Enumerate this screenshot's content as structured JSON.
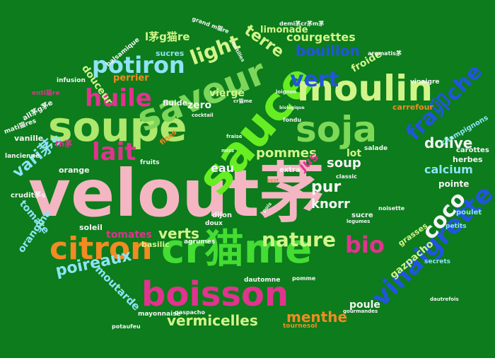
{
  "background_color": "#0c7c1c",
  "words": [
    {
      "text": "velout茅",
      "color": "#f4b6c2"
    },
    {
      "text": "soupe",
      "color": "#aee86c"
    },
    {
      "text": "sauce",
      "color": "#66ee22"
    },
    {
      "text": "saveur",
      "color": "#7cd65a"
    },
    {
      "text": "moulin",
      "color": "#d2f58a"
    },
    {
      "text": "soja",
      "color": "#7ed957"
    },
    {
      "text": "boisson",
      "color": "#e0348f"
    },
    {
      "text": "cr猫me",
      "color": "#44dd33"
    },
    {
      "text": "citron",
      "color": "#f28b22"
    },
    {
      "text": "potiron",
      "color": "#8fe3f7"
    },
    {
      "text": "vinaigrette",
      "color": "#2255dd"
    },
    {
      "text": "lait",
      "color": "#e0348f"
    },
    {
      "text": "huile",
      "color": "#e0348f"
    },
    {
      "text": "bio",
      "color": "#e0348f"
    },
    {
      "text": "nature",
      "color": "#d2f58a"
    },
    {
      "text": "vert",
      "color": "#2255dd"
    },
    {
      "text": "light",
      "color": "#d2f58a"
    },
    {
      "text": "bouillon",
      "color": "#2255dd"
    },
    {
      "text": "coco",
      "color": "#f4f4f4"
    },
    {
      "text": "fra卯che",
      "color": "#2255dd"
    },
    {
      "text": "poireaux",
      "color": "#8fe3f7"
    },
    {
      "text": "menthe",
      "color": "#f28b22"
    },
    {
      "text": "vermicelles",
      "color": "#d2f58a"
    },
    {
      "text": "pommes",
      "color": "#d2f58a"
    },
    {
      "text": "terre",
      "color": "#d2f58a"
    },
    {
      "text": "courgettes",
      "color": "#d2f58a"
    },
    {
      "text": "limonade",
      "color": "#d2f58a"
    },
    {
      "text": "vari茅s",
      "color": "#8fe3f7"
    },
    {
      "text": "verts",
      "color": "#d2f58a"
    },
    {
      "text": "pur",
      "color": "#f4f4f4"
    },
    {
      "text": "knorr",
      "color": "#f4f4f4"
    },
    {
      "text": "soup",
      "color": "#f4f4f4"
    },
    {
      "text": "jus",
      "color": "#e0348f"
    },
    {
      "text": "eau",
      "color": "#f4f4f4"
    },
    {
      "text": "dolive",
      "color": "#f4f4f4"
    },
    {
      "text": "calcium",
      "color": "#8fe3f7"
    },
    {
      "text": "gazpacho",
      "color": "#d2f58a"
    },
    {
      "text": "moutarde",
      "color": "#8fe3f7"
    },
    {
      "text": "tomates",
      "color": "#e0348f"
    },
    {
      "text": "tomate",
      "color": "#8fe3f7"
    },
    {
      "text": "orangina",
      "color": "#8fe3f7"
    },
    {
      "text": "douceur",
      "color": "#d2f58a"
    },
    {
      "text": "froide",
      "color": "#d2f58a"
    },
    {
      "text": "vierge",
      "color": "#d2f58a"
    },
    {
      "text": "zero",
      "color": "#f4f4f4"
    },
    {
      "text": "poule",
      "color": "#f4f4f4"
    },
    {
      "text": "lot",
      "color": "#d2f58a"
    },
    {
      "text": "l茅g猫re",
      "color": "#d2f58a"
    },
    {
      "text": "sucres",
      "color": "#8fe3f7"
    },
    {
      "text": "perrier",
      "color": "#f28b22"
    },
    {
      "text": "carrefour",
      "color": "#f28b22"
    },
    {
      "text": "champignons",
      "color": "#8fe3f7"
    },
    {
      "text": "soleil",
      "color": "#f4f4f4"
    },
    {
      "text": "basilic",
      "color": "#d2f58a"
    },
    {
      "text": "grasses",
      "color": "#d2f58a"
    },
    {
      "text": "pointe",
      "color": "#f4f4f4"
    },
    {
      "text": "herbes",
      "color": "#f4f4f4"
    },
    {
      "text": "carottes",
      "color": "#f4f4f4"
    },
    {
      "text": "poulet",
      "color": "#8fe3f7"
    },
    {
      "text": "orange",
      "color": "#f4f4f4"
    },
    {
      "text": "vanille",
      "color": "#f4f4f4"
    },
    {
      "text": "fluide",
      "color": "#f4f4f4"
    },
    {
      "text": "fines",
      "color": "#f28b22"
    },
    {
      "text": "sucre",
      "color": "#f4f4f4"
    },
    {
      "text": "agrumes",
      "color": "#f4f4f4"
    },
    {
      "text": "extra",
      "color": "#f4f4f4"
    },
    {
      "text": "dijon",
      "color": "#f4f4f4"
    },
    {
      "text": "doux",
      "color": "#f4f4f4"
    },
    {
      "text": "th茅",
      "color": "#e0348f"
    },
    {
      "text": "secrets",
      "color": "#8fe3f7"
    },
    {
      "text": "petits",
      "color": "#8fe3f7"
    },
    {
      "text": "vinaigre",
      "color": "#f4f4f4"
    },
    {
      "text": "infusion",
      "color": "#f4f4f4"
    },
    {
      "text": "fondu",
      "color": "#f4f4f4"
    },
    {
      "text": "fruits",
      "color": "#f4f4f4"
    },
    {
      "text": "salade",
      "color": "#f4f4f4"
    },
    {
      "text": "tournesol",
      "color": "#f28b22"
    },
    {
      "text": "crudit茅s",
      "color": "#f4f4f4"
    },
    {
      "text": "gaspacho",
      "color": "#f4f4f4"
    },
    {
      "text": "mayonnaise",
      "color": "#f4f4f4"
    },
    {
      "text": "potaufeu",
      "color": "#f4f4f4"
    },
    {
      "text": "cocktail",
      "color": "#f4f4f4"
    },
    {
      "text": "cr猫me",
      "color": "#f4f4f4"
    },
    {
      "text": "lancienne",
      "color": "#f4f4f4"
    },
    {
      "text": "balsamique",
      "color": "#f4f4f4"
    },
    {
      "text": "all茅g茅e",
      "color": "#f4f4f4"
    },
    {
      "text": "mati猫res",
      "color": "#f4f4f4"
    },
    {
      "text": "enti猫re",
      "color": "#e0348f"
    },
    {
      "text": "grand m猫re",
      "color": "#f4f4f4"
    },
    {
      "text": "demi茅cr茅m茅",
      "color": "#f4f4f4"
    },
    {
      "text": "aromatis茅",
      "color": "#f4f4f4"
    },
    {
      "text": "lentilles",
      "color": "#f4f4f4"
    },
    {
      "text": "loignon",
      "color": "#f4f4f4"
    },
    {
      "text": "biologique",
      "color": "#f4f4f4"
    },
    {
      "text": "gourmandes",
      "color": "#f4f4f4"
    },
    {
      "text": "dautomne",
      "color": "#f4f4f4"
    },
    {
      "text": "pomme",
      "color": "#f4f4f4"
    },
    {
      "text": "classic",
      "color": "#f4f4f4"
    },
    {
      "text": "noisette",
      "color": "#f4f4f4"
    },
    {
      "text": "fraise",
      "color": "#f4f4f4"
    },
    {
      "text": "miss",
      "color": "#f4f4f4"
    },
    {
      "text": "pois",
      "color": "#f4f4f4"
    },
    {
      "text": "legumes",
      "color": "#f4f4f4"
    },
    {
      "text": "dautrefois",
      "color": "#f4f4f4"
    },
    {
      "text": "zest",
      "color": "#f28b22"
    }
  ]
}
